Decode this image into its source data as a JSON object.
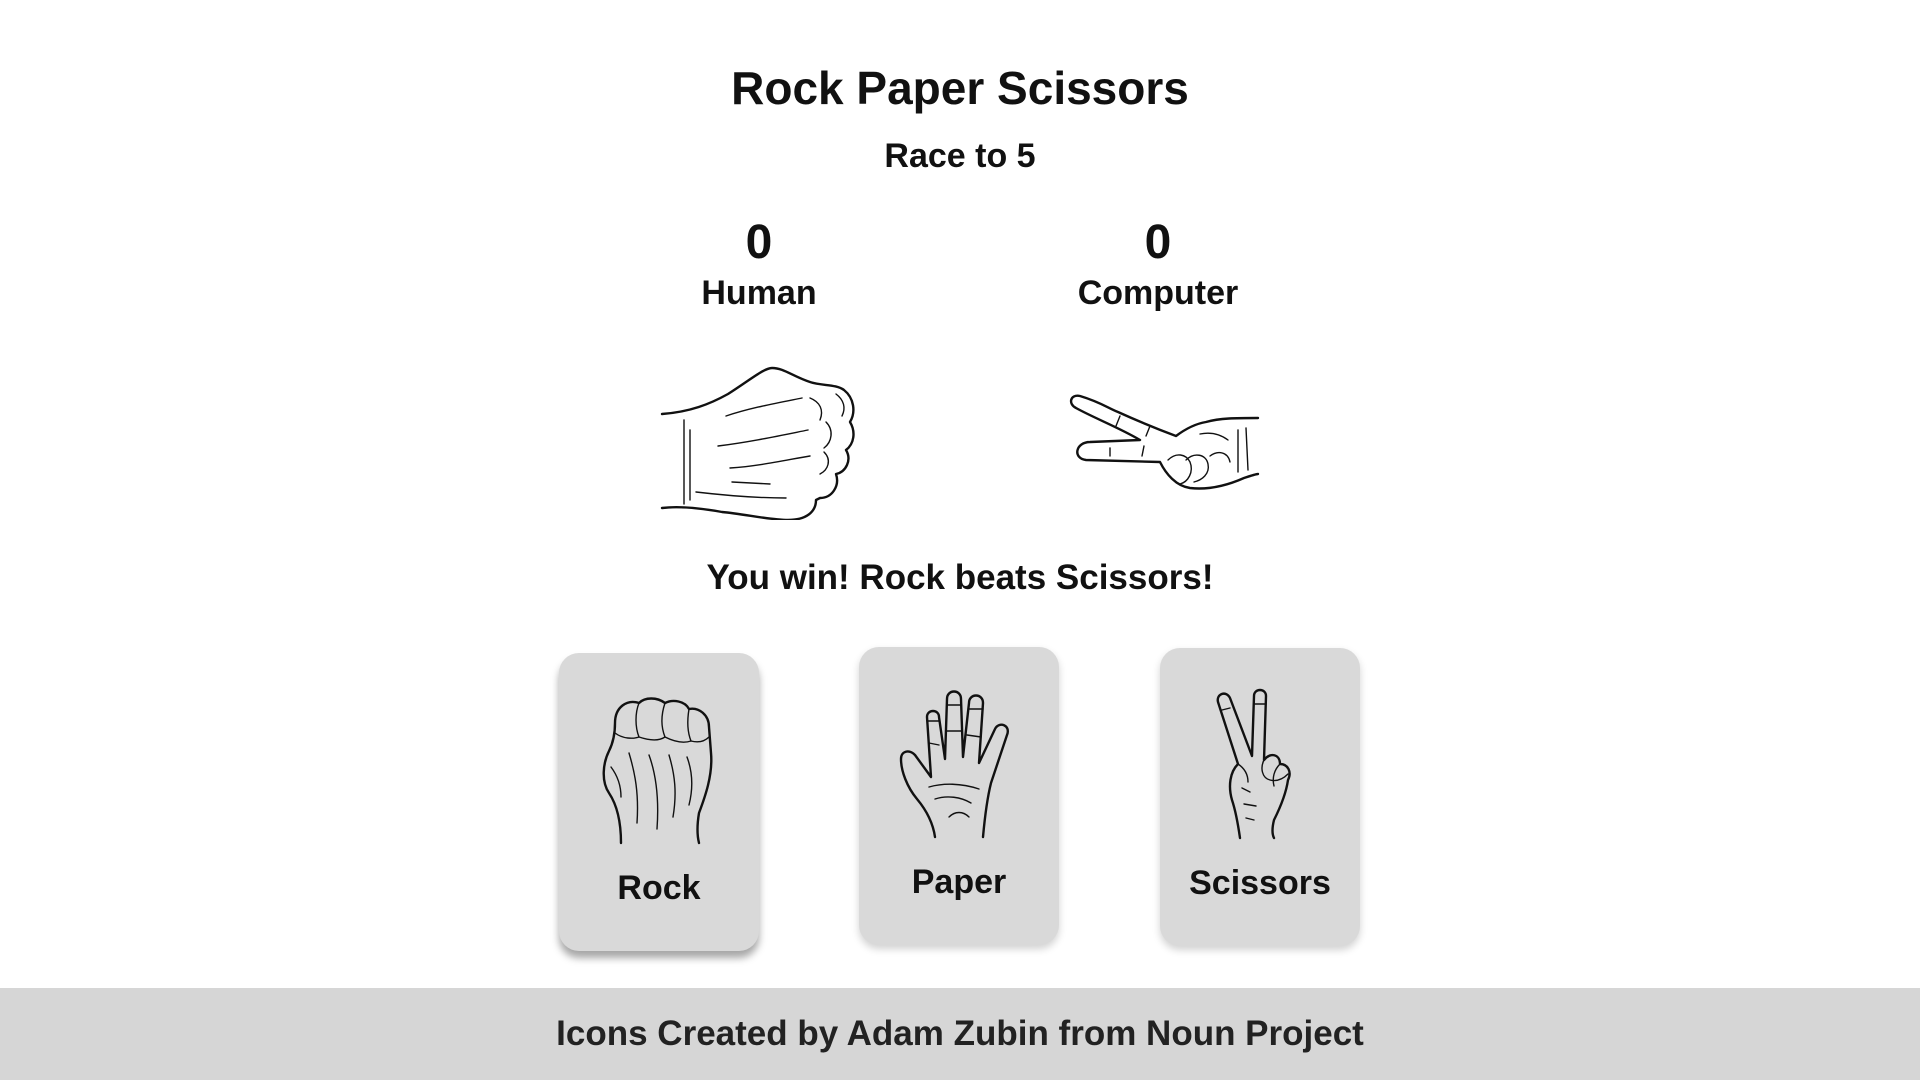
{
  "header": {
    "title": "Rock Paper Scissors",
    "subtitle": "Race to 5"
  },
  "scoreboard": {
    "human": {
      "score": "0",
      "label": "Human"
    },
    "computer": {
      "score": "0",
      "label": "Computer"
    }
  },
  "round": {
    "human_choice": "rock-hand-icon",
    "computer_choice": "scissors-hand-icon",
    "result": "You win! Rock beats Scissors!"
  },
  "choices": [
    {
      "label": "Rock",
      "icon": "rock-hand-icon"
    },
    {
      "label": "Paper",
      "icon": "paper-hand-icon"
    },
    {
      "label": "Scissors",
      "icon": "scissors-hand-icon"
    }
  ],
  "footer": {
    "credit": "Icons Created by Adam Zubin from Noun Project"
  },
  "colors": {
    "background": "#ffffff",
    "card": "#d9d9d9",
    "footer": "#d6d6d6",
    "text": "#111111"
  }
}
